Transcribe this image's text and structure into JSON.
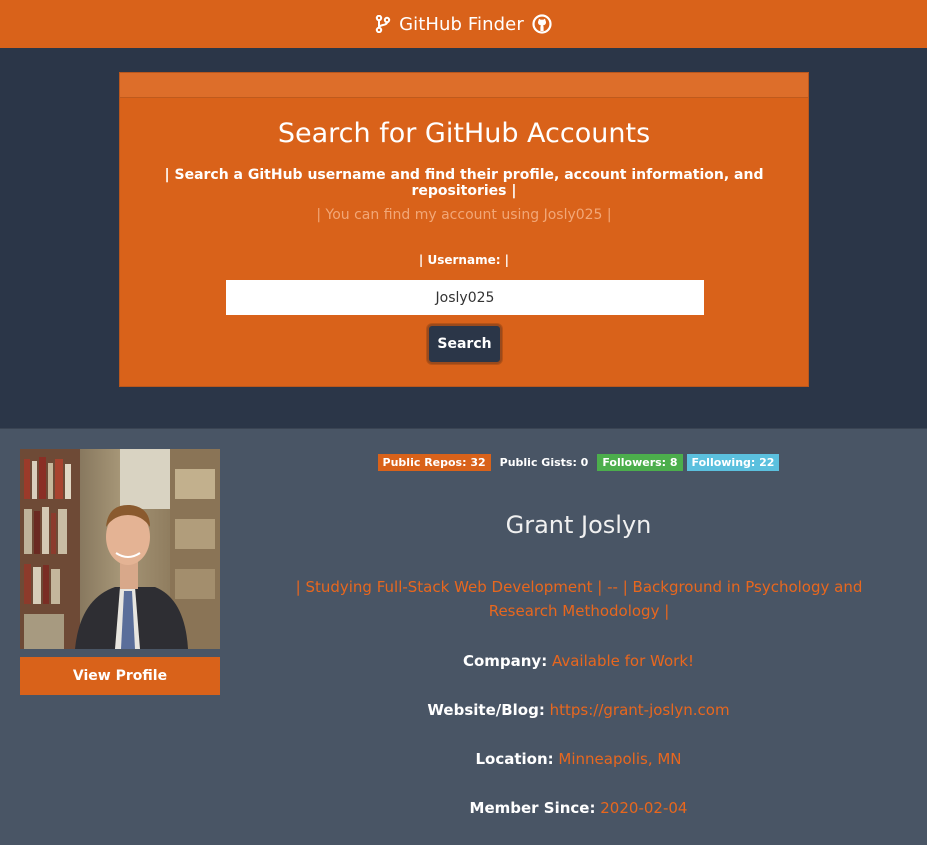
{
  "navbar": {
    "brand": "GitHub Finder",
    "left_icon": "code-branch-icon",
    "right_icon": "github-icon"
  },
  "search": {
    "title": "Search for GitHub Accounts",
    "description": "| Search a GitHub username and find their profile, account information, and repositories |",
    "hint": "| You can find my account using Josly025 |",
    "username_label": "| Username: |",
    "username_value": "Josly025",
    "button_label": "Search"
  },
  "profile": {
    "view_profile_label": "View Profile",
    "badges": {
      "public_repos": "Public Repos: 32",
      "public_gists": "Public Gists: 0",
      "followers": "Followers: 8",
      "following": "Following: 22"
    },
    "name": "Grant Joslyn",
    "bio": "| Studying Full-Stack Web Development | -- | Background in Psychology and Research Methodology |",
    "company": {
      "label": "Company:",
      "value": "Available for Work!"
    },
    "website": {
      "label": "Website/Blog:",
      "value": "https://grant-joslyn.com"
    },
    "location": {
      "label": "Location:",
      "value": "Minneapolis, MN"
    },
    "member_since": {
      "label": "Member Since:",
      "value": "2020-02-04"
    }
  },
  "colors": {
    "accent": "#d9621a",
    "hero_bg": "#2b3648",
    "profile_bg": "#495565",
    "followers_badge": "#4cae4c",
    "following_badge": "#5bc0de"
  }
}
